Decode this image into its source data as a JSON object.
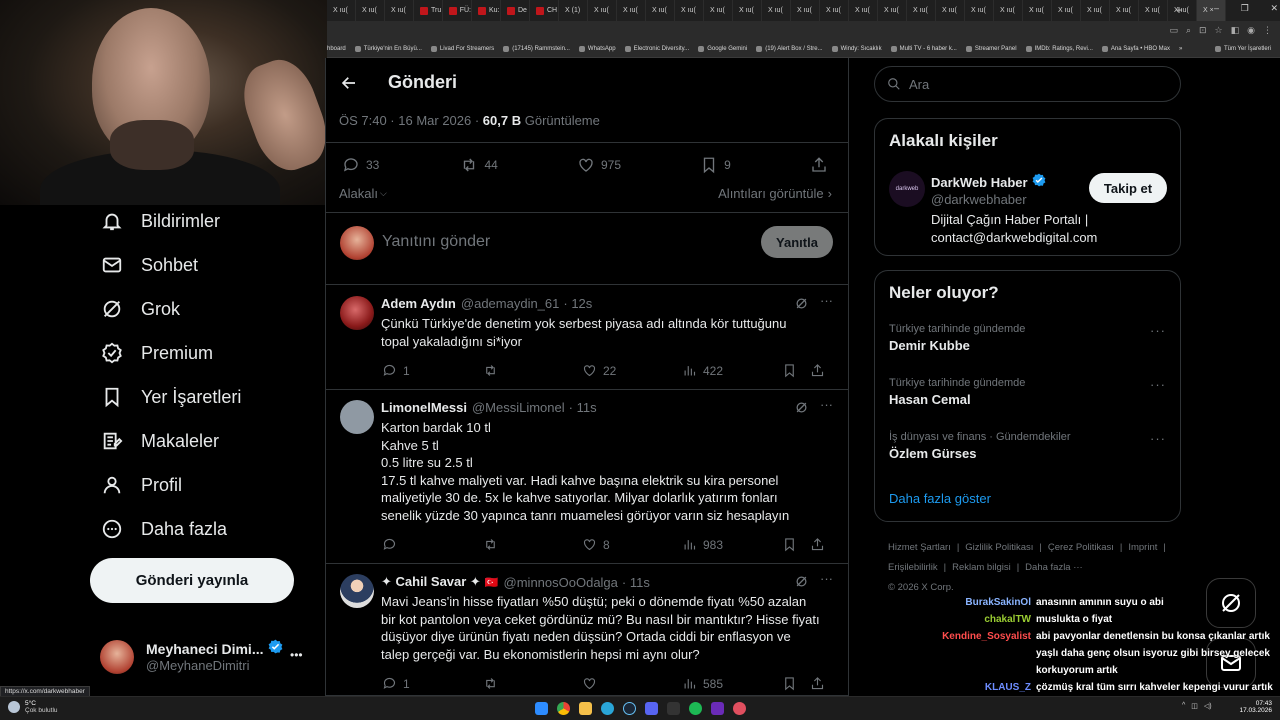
{
  "browser": {
    "tabs": [
      {
        "label": "X ıu(",
        "kind": "x"
      },
      {
        "label": "X ıu(",
        "kind": "x"
      },
      {
        "label": "X ıu(",
        "kind": "x"
      },
      {
        "label": "Tru",
        "kind": "red"
      },
      {
        "label": "FÜ:",
        "kind": "red"
      },
      {
        "label": "Ku:",
        "kind": "red"
      },
      {
        "label": "De",
        "kind": "red"
      },
      {
        "label": "CH",
        "kind": "red"
      },
      {
        "label": "X (1)",
        "kind": "x"
      },
      {
        "label": "X ıu(",
        "kind": "x"
      },
      {
        "label": "X ıu(",
        "kind": "x"
      },
      {
        "label": "X ıu(",
        "kind": "x"
      },
      {
        "label": "X ıu(",
        "kind": "x"
      },
      {
        "label": "X ıu(",
        "kind": "x"
      },
      {
        "label": "X ıu(",
        "kind": "x"
      },
      {
        "label": "X ıu(",
        "kind": "x"
      },
      {
        "label": "X ıu(",
        "kind": "x"
      },
      {
        "label": "X ıu(",
        "kind": "x"
      },
      {
        "label": "X ıu(",
        "kind": "x"
      },
      {
        "label": "X ıu(",
        "kind": "x"
      },
      {
        "label": "X ıu(",
        "kind": "x"
      },
      {
        "label": "X ıu(",
        "kind": "x"
      },
      {
        "label": "X ıu(",
        "kind": "x"
      },
      {
        "label": "X ıu(",
        "kind": "x"
      },
      {
        "label": "X ıu(",
        "kind": "x"
      },
      {
        "label": "X ıu(",
        "kind": "x"
      },
      {
        "label": "X ıu(",
        "kind": "x"
      },
      {
        "label": "X ıu(",
        "kind": "x"
      },
      {
        "label": "X ıu(",
        "kind": "x"
      },
      {
        "label": "X ıu(",
        "kind": "x"
      },
      {
        "label": "X ×",
        "kind": "active"
      }
    ],
    "bookmarks": [
      "hboard",
      "Türkiye'nin En Büyü...",
      "Livad For Streamers",
      "(17145) Rammstein...",
      "WhatsApp",
      "Electronic Diversity...",
      "Google Gemini",
      "(19) Alert Box / Stre...",
      "Windy: Sıcaklık",
      "Multi TV - 6 haber k...",
      "Streamer Panel",
      "IMDb: Ratings, Revi...",
      "Ana Sayfa • HBO Max",
      "»",
      "Tüm Yer İşaretleri"
    ],
    "status_url": "https://x.com/darkwebhaber"
  },
  "nav": {
    "items": [
      {
        "label": "Bildirimler",
        "icon": "bell-icon"
      },
      {
        "label": "Sohbet",
        "icon": "mail-icon"
      },
      {
        "label": "Grok",
        "icon": "grok-icon"
      },
      {
        "label": "Premium",
        "icon": "premium-icon"
      },
      {
        "label": "Yer İşaretleri",
        "icon": "bookmark-icon"
      },
      {
        "label": "Makaleler",
        "icon": "article-icon"
      },
      {
        "label": "Profil",
        "icon": "profile-icon"
      },
      {
        "label": "Daha fazla",
        "icon": "more-circle-icon"
      }
    ],
    "post_button": "Gönderi yayınla",
    "account": {
      "name": "Meyhaneci Dimi...",
      "handle": "@MeyhaneDimitri",
      "more": "•••"
    }
  },
  "header": {
    "title": "Gönderi"
  },
  "post": {
    "time": "ÖS 7:40 · 16 Mar 2026 · ",
    "views_count": "60,7 B",
    "views_label": " Görüntüleme",
    "replies": "33",
    "reposts": "44",
    "likes": "975",
    "bookmarks": "9",
    "sort_label": "Alakalı",
    "quotes_label": "Alıntıları görüntüle",
    "reply_placeholder": "Yanıtını gönder",
    "reply_button": "Yanıtla"
  },
  "replies": [
    {
      "name": "Adem Aydın",
      "handle": "@ademaydin_61",
      "time": "· 12s",
      "text": "Çünkü Türkiye'de denetim yok serbest piyasa adı altında kör tuttuğunu\ntopal yakaladığını si*iyor",
      "replies": "1",
      "reposts": "",
      "likes": "22",
      "views": "422"
    },
    {
      "name": "LimonelMessi",
      "handle": "@MessiLimonel",
      "time": "· 11s",
      "text": "Karton bardak 10 tl\nKahve 5 tl\n0.5 litre su 2.5 tl\n17.5 tl kahve maliyeti var. Hadi kahve başına elektrik su kira personel\nmaliyetiyle 30 de. 5x le kahve satıyorlar. Milyar dolarlık yatırım fonları\nsenelik yüzde 30 yapınca tanrı muamelesi görüyor varın siz hesaplayın",
      "replies": "",
      "reposts": "",
      "likes": "8",
      "views": "983"
    },
    {
      "name": "✦ Cahil Savar ✦",
      "flag": "🇹🇷",
      "handle": "@minnosOoOdalga",
      "time": "· 11s",
      "text": "Mavi Jeans'in hisse fiyatları %50 düştü; peki o dönemde fiyatı %50 azalan\nbir kot pantolon veya ceket gördünüz mü? Bu nasıl bir mantıktır? Hisse fiyatı\ndüşüyor diye ürünün fiyatı neden düşsün? Ortada ciddi bir enflasyon ve\ntalep gerçeği var. Bu ekonomistlerin hepsi mi aynı olur?",
      "replies": "1",
      "reposts": "",
      "likes": "",
      "views": "585"
    }
  ],
  "search": {
    "placeholder": "Ara"
  },
  "related": {
    "title": "Alakalı kişiler",
    "name": "DarkWeb Haber",
    "handle": "@darkwebhaber",
    "follow": "Takip et",
    "bio": "Dijital Çağın Haber Portalı |\ncontact@darkwebdigital.com",
    "avatar_text": "darkweb"
  },
  "trends": {
    "title": "Neler oluyor?",
    "items": [
      {
        "category": "Türkiye tarihinde gündemde",
        "name": "Demir Kubbe"
      },
      {
        "category": "Türkiye tarihinde gündemde",
        "name": "Hasan Cemal"
      },
      {
        "category": "İş dünyası ve finans · Gündemdekiler",
        "name": "Özlem Gürses"
      }
    ],
    "more": "Daha fazla göster"
  },
  "footer": {
    "links": [
      "Hizmet Şartları",
      "|",
      "Gizlilik Politikası",
      "|",
      "Çerez Politikası",
      "|",
      "Imprint",
      "|",
      "Erişilebilirlik",
      "|",
      "Reklam bilgisi",
      "|",
      "Daha fazla ···"
    ],
    "copyright": "© 2026 X Corp."
  },
  "chat": [
    {
      "user": "BurakSakinOl",
      "color": "#8ab4ff",
      "text": "anasının amının suyu o abi"
    },
    {
      "user": "chakalTW",
      "color": "#9acd32",
      "text": "muslukta o fiyat"
    },
    {
      "user": "Kendine_Sosyalist",
      "color": "#ff4d4d",
      "text": "abi pavyonlar denetlensin bu konsa çıkanlar artık yaşlı daha genç olsun isyoruz gibi birsey gelecek korkuyorum artık"
    },
    {
      "user": "KLAUS_Z",
      "color": "#6d8dff",
      "text": "çözmüş kral tüm sırrı kahveler kepengi vurur artık"
    }
  ],
  "taskbar": {
    "weather_temp": "5°C",
    "weather_text": "Çok bulutlu",
    "time": "07:43",
    "date": "17.03.2026"
  }
}
